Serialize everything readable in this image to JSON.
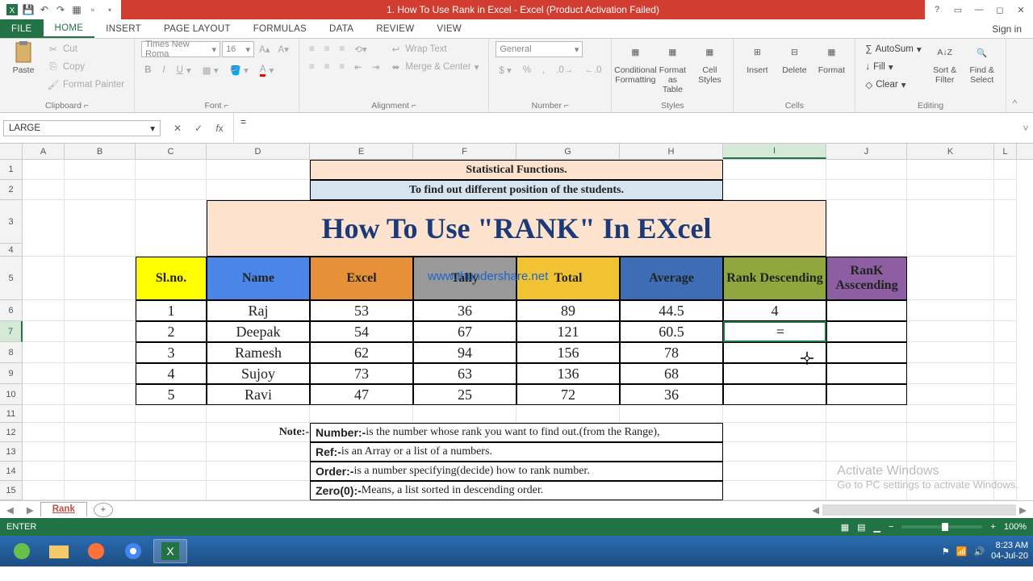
{
  "title": "1. How To Use Rank in Excel -  Excel (Product Activation Failed)",
  "tabs": {
    "file": "FILE",
    "home": "HOME",
    "insert": "INSERT",
    "page": "PAGE LAYOUT",
    "formulas": "FORMULAS",
    "data": "DATA",
    "review": "REVIEW",
    "view": "VIEW"
  },
  "signin": "Sign in",
  "ribbon": {
    "clipboard": {
      "label": "Clipboard",
      "paste": "Paste",
      "cut": "Cut",
      "copy": "Copy",
      "painter": "Format Painter"
    },
    "font": {
      "label": "Font",
      "name": "Times New Roma",
      "size": "16"
    },
    "alignment": {
      "label": "Alignment",
      "wrap": "Wrap Text",
      "merge": "Merge & Center"
    },
    "number": {
      "label": "Number",
      "format": "General"
    },
    "styles": {
      "label": "Styles",
      "cond": "Conditional\nFormatting",
      "table": "Format as\nTable",
      "cell": "Cell\nStyles"
    },
    "cells": {
      "label": "Cells",
      "insert": "Insert",
      "delete": "Delete",
      "format": "Format"
    },
    "editing": {
      "label": "Editing",
      "autosum": "AutoSum",
      "fill": "Fill",
      "clear": "Clear",
      "sort": "Sort &\nFilter",
      "find": "Find &\nSelect"
    }
  },
  "namebox": "LARGE",
  "formula": "=",
  "columns": [
    "A",
    "B",
    "C",
    "D",
    "E",
    "F",
    "G",
    "H",
    "I",
    "J",
    "K",
    "L"
  ],
  "rows": [
    "1",
    "2",
    "3",
    "4",
    "5",
    "6",
    "7",
    "8",
    "9",
    "10",
    "11",
    "12",
    "13",
    "14",
    "15"
  ],
  "content": {
    "r1": "Statistical Functions.",
    "r2": "To find out different position of the students.",
    "bigtitle": "How To Use \"RANK\" In EXcel",
    "watermark": "www.thundershare.net",
    "headers": {
      "slno": "Sl.no.",
      "name": "Name",
      "excel": "Excel",
      "tally": "Tally",
      "total": "Total",
      "avg": "Average",
      "rdesc": "Rank Descending",
      "rasc": "RanK Asscending"
    },
    "data": [
      {
        "slno": "1",
        "name": "Raj",
        "excel": "53",
        "tally": "36",
        "total": "89",
        "avg": "44.5",
        "rdesc": "4"
      },
      {
        "slno": "2",
        "name": "Deepak",
        "excel": "54",
        "tally": "67",
        "total": "121",
        "avg": "60.5",
        "rdesc": "="
      },
      {
        "slno": "3",
        "name": "Ramesh",
        "excel": "62",
        "tally": "94",
        "total": "156",
        "avg": "78",
        "rdesc": ""
      },
      {
        "slno": "4",
        "name": "Sujoy",
        "excel": "73",
        "tally": "63",
        "total": "136",
        "avg": "68",
        "rdesc": ""
      },
      {
        "slno": "5",
        "name": "Ravi",
        "excel": "47",
        "tally": "25",
        "total": "72",
        "avg": "36",
        "rdesc": ""
      }
    ],
    "notelabel": "Note:-",
    "notes": [
      "Number:-is the number whose rank you want to find out.(from the Range),",
      "Ref:- is an Array or a list of a numbers.",
      "Order:-is a number specifying(decide) how to rank number.",
      "Zero(0):-Means, a list sorted in descending order."
    ]
  },
  "chart_data": {
    "type": "table",
    "title": "How To Use \"RANK\" In EXcel",
    "columns": [
      "Sl.no.",
      "Name",
      "Excel",
      "Tally",
      "Total",
      "Average",
      "Rank Descending",
      "RanK Asscending"
    ],
    "rows": [
      [
        1,
        "Raj",
        53,
        36,
        89,
        44.5,
        4,
        null
      ],
      [
        2,
        "Deepak",
        54,
        67,
        121,
        60.5,
        null,
        null
      ],
      [
        3,
        "Ramesh",
        62,
        94,
        156,
        78,
        null,
        null
      ],
      [
        4,
        "Sujoy",
        73,
        63,
        136,
        68,
        null,
        null
      ],
      [
        5,
        "Ravi",
        47,
        25,
        72,
        36,
        null,
        null
      ]
    ]
  },
  "activate": {
    "t1": "Activate Windows",
    "t2": "Go to PC settings to activate Windows."
  },
  "sheet": "Rank",
  "status": "ENTER",
  "zoom": "100%",
  "clock": {
    "time": "8:23 AM",
    "date": "04-Jul-20"
  }
}
